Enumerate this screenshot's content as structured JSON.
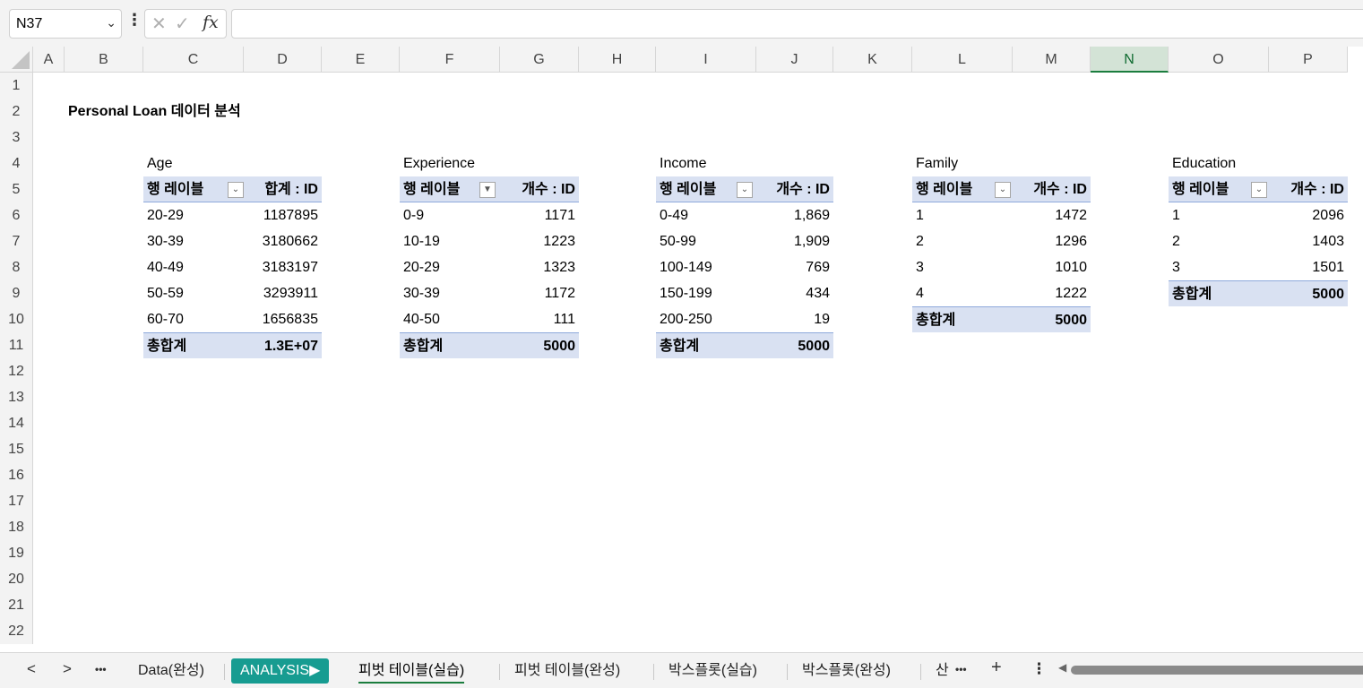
{
  "formula_bar": {
    "name_box": "N37",
    "fx_label": "fx",
    "formula": ""
  },
  "columns": [
    "A",
    "B",
    "C",
    "D",
    "E",
    "F",
    "G",
    "H",
    "I",
    "J",
    "K",
    "L",
    "M",
    "N",
    "O",
    "P"
  ],
  "selected_column": "N",
  "rows": [
    "1",
    "2",
    "3",
    "4",
    "5",
    "6",
    "7",
    "8",
    "9",
    "10",
    "11",
    "12",
    "13",
    "14",
    "15",
    "16",
    "17",
    "18",
    "19",
    "20",
    "21",
    "22"
  ],
  "title": "Personal Loan 데이터 분석",
  "pivots": [
    {
      "caption": "Age",
      "header_label": "행 레이블",
      "header_value": "합계 : ID",
      "filtered": false,
      "rows": [
        {
          "label": "20-29",
          "value": "1187895"
        },
        {
          "label": "30-39",
          "value": "3180662"
        },
        {
          "label": "40-49",
          "value": "3183197"
        },
        {
          "label": "50-59",
          "value": "3293911"
        },
        {
          "label": "60-70",
          "value": "1656835"
        }
      ],
      "total_label": "총합계",
      "total_value": "1.3E+07"
    },
    {
      "caption": "Experience",
      "header_label": "행 레이블",
      "header_value": "개수 : ID",
      "filtered": true,
      "rows": [
        {
          "label": "0-9",
          "value": "1171"
        },
        {
          "label": "10-19",
          "value": "1223"
        },
        {
          "label": "20-29",
          "value": "1323"
        },
        {
          "label": "30-39",
          "value": "1172"
        },
        {
          "label": "40-50",
          "value": "111"
        }
      ],
      "total_label": "총합계",
      "total_value": "5000"
    },
    {
      "caption": "Income",
      "header_label": "행 레이블",
      "header_value": "개수 : ID",
      "filtered": false,
      "rows": [
        {
          "label": "0-49",
          "value": "1,869"
        },
        {
          "label": "50-99",
          "value": "1,909"
        },
        {
          "label": "100-149",
          "value": "769"
        },
        {
          "label": "150-199",
          "value": "434"
        },
        {
          "label": "200-250",
          "value": "19"
        }
      ],
      "total_label": "총합계",
      "total_value": "5000"
    },
    {
      "caption": "Family",
      "header_label": "행 레이블",
      "header_value": "개수 : ID",
      "filtered": false,
      "rows": [
        {
          "label": "1",
          "value": "1472"
        },
        {
          "label": "2",
          "value": "1296"
        },
        {
          "label": "3",
          "value": "1010"
        },
        {
          "label": "4",
          "value": "1222"
        }
      ],
      "total_label": "총합계",
      "total_value": "5000"
    },
    {
      "caption": "Education",
      "header_label": "행 레이블",
      "header_value": "개수 : ID",
      "filtered": false,
      "rows": [
        {
          "label": "1",
          "value": "2096"
        },
        {
          "label": "2",
          "value": "1403"
        },
        {
          "label": "3",
          "value": "1501"
        }
      ],
      "total_label": "총합계",
      "total_value": "5000"
    }
  ],
  "sheet_tabs": {
    "tabs": [
      {
        "label": "Data(완성)",
        "style": "normal"
      },
      {
        "label": "ANALYSIS▶",
        "style": "green"
      },
      {
        "label": "피벗 테이블(실습)",
        "style": "active"
      },
      {
        "label": "피벗 테이블(완성)",
        "style": "normal"
      },
      {
        "label": "박스플롯(실습)",
        "style": "normal"
      },
      {
        "label": "박스플롯(완성)",
        "style": "normal"
      },
      {
        "label": "산",
        "style": "normal"
      }
    ],
    "prev": "<",
    "next": ">",
    "more": "•••",
    "add": "+",
    "options": "⋮"
  },
  "colors": {
    "pivot_fill": "#d9e1f2",
    "selected_header": "#d3e3d6",
    "accent_green": "#1b7d3e",
    "tab_green": "#179c91"
  }
}
